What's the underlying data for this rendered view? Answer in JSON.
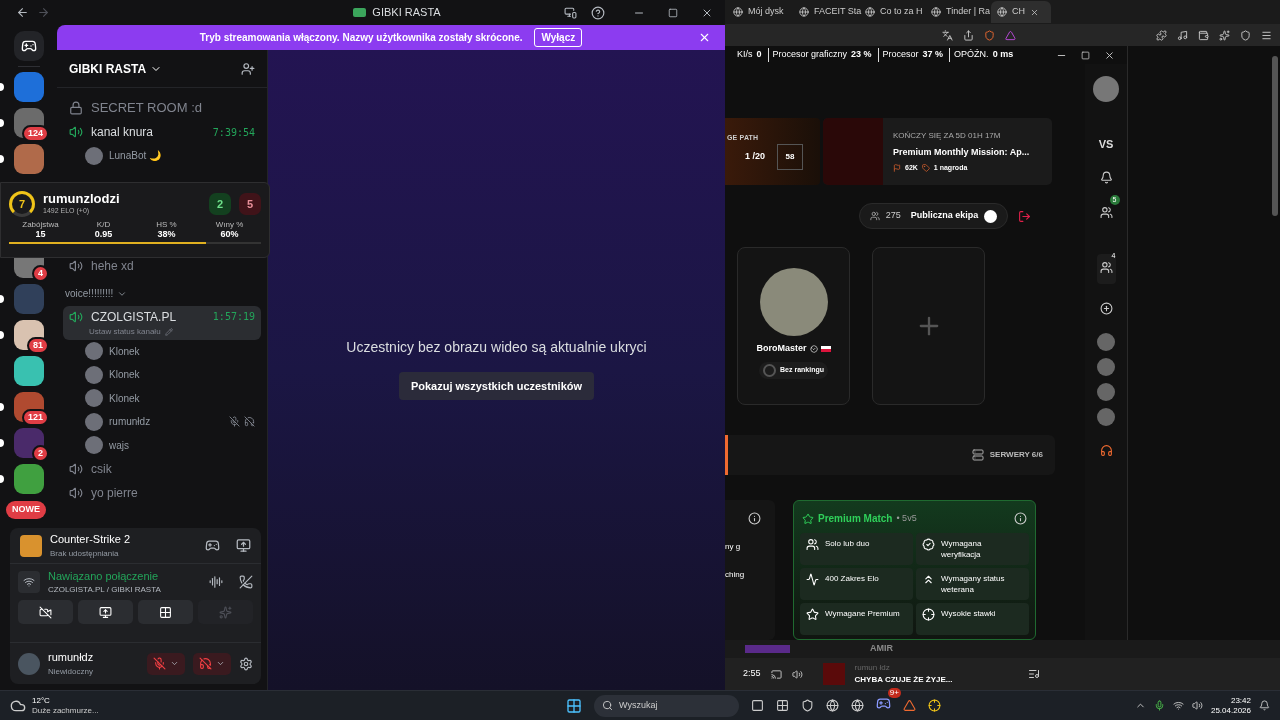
{
  "discord": {
    "title": "GIBKI RASTA",
    "banner": {
      "text": "Tryb streamowania włączony. Nazwy użytkownika zostały skrócone.",
      "button": "Wyłącz"
    },
    "servers": [
      {
        "unread": true
      },
      {
        "unread": true,
        "badge": "124"
      },
      {
        "unread": true
      },
      {
        "unread": false,
        "badge": "4"
      },
      {
        "unread": true
      },
      {
        "unread": true,
        "badge": "81"
      },
      {
        "unread": false
      },
      {
        "unread": true,
        "badge": "121"
      },
      {
        "unread": true,
        "badge": "2"
      },
      {
        "unread": true
      }
    ],
    "new_pill": "NOWE",
    "server_name": "GIBKI RASTA",
    "channels": [
      {
        "kind": "locked",
        "name": "SECRET ROOM :d"
      },
      {
        "kind": "voice",
        "name": "kanal knura",
        "active": true,
        "selected": false,
        "timer": "7:39:54",
        "members": [
          {
            "name": "LunaBot 🌙",
            "muted": false
          }
        ]
      },
      {
        "kind": "spacer"
      },
      {
        "kind": "voice",
        "name": "hehe xd",
        "active": false,
        "selected": false
      },
      {
        "kind": "category",
        "name": "voice!!!!!!!!!"
      },
      {
        "kind": "voice",
        "name": "CZOLGISTA.PL",
        "active": true,
        "selected": true,
        "timer": "1:57:19",
        "status": "Ustaw status kanału",
        "members": [
          {
            "name": "Klonek",
            "muted": false
          },
          {
            "name": "Klonek",
            "muted": false
          },
          {
            "name": "Klonek",
            "muted": false
          },
          {
            "name": "rumunłdz",
            "muted": true
          },
          {
            "name": "wajs",
            "muted": false
          }
        ]
      },
      {
        "kind": "voice",
        "name": "csik",
        "active": false,
        "selected": false
      },
      {
        "kind": "voice",
        "name": "yo pierre",
        "active": false,
        "selected": false
      }
    ],
    "activity": {
      "game": "Counter-Strike 2",
      "status": "Brak udostępniania"
    },
    "voice": {
      "status": "Nawiązano połączenie",
      "channel": "CZOLGISTA.PL / GIBKI RASTA"
    },
    "user": {
      "name": "rumunłdz",
      "status": "Niewidoczny",
      "mic_muted": true,
      "deafened": true
    },
    "main": {
      "message": "Uczestnicy bez obrazu wideo są aktualnie ukryci",
      "button": "Pokazuj wszystkich uczestników"
    }
  },
  "stats_overlay": {
    "level_badge": "7",
    "name": "rumunzlodzi",
    "elo": "1492 ELO (+0)",
    "wins": "2",
    "losses": "5",
    "level": 0.78,
    "stats": [
      {
        "label": "Zabójstwa",
        "value": "15"
      },
      {
        "label": "K/D",
        "value": "0.95"
      },
      {
        "label": "HS %",
        "value": "38%"
      },
      {
        "label": "Wıny %",
        "value": "60%"
      }
    ]
  },
  "browser": {
    "tabs": [
      {
        "title": "Mój dysk",
        "selected": false
      },
      {
        "title": "FACEIT Sta",
        "selected": false
      },
      {
        "title": "Co to za H",
        "selected": false
      },
      {
        "title": "Tinder | Ra",
        "selected": false
      },
      {
        "title": "CH",
        "selected": true
      }
    ],
    "osd": [
      {
        "label": "KI/s",
        "value": "0"
      },
      {
        "label": "Procesor graficzny",
        "value": "23 %"
      },
      {
        "label": "Procesor",
        "value": "37 %"
      },
      {
        "label": "OPÓŹN.",
        "value": "0 ms"
      }
    ]
  },
  "faceit": {
    "mission": {
      "path_label": "GE PATH",
      "progress": "1 /20",
      "level": "58",
      "ends": "KOŃCZY SIĘ ZA 5D 01H 17M",
      "title": "Premium Monthly Mission: Ap...",
      "points": "62K",
      "reward": "1 nagroda"
    },
    "party": {
      "count": "275",
      "label": "Publiczna ekipa",
      "public": true
    },
    "player": {
      "name": "BoroMaster",
      "rank": "Bez rankingu"
    },
    "servers": "SERWERY 6/6",
    "partial_card": [
      "ny g",
      "ching"
    ],
    "match": {
      "title": "Premium Match",
      "mode": "• 5v5",
      "features": [
        {
          "kind": "users",
          "text": "Solo lub duo"
        },
        {
          "kind": "verified",
          "text": "Wymagana weryfikacja"
        },
        {
          "kind": "elo",
          "text": "400 Zakres Elo"
        },
        {
          "kind": "veteran",
          "text": "Wymagany status weterana"
        },
        {
          "kind": "premium",
          "text": "Wymagane Premium"
        },
        {
          "kind": "stakes",
          "text": "Wysokie stawki"
        }
      ]
    },
    "rail": {
      "vs": "VS",
      "notif_badge": "5",
      "party_badge": "4"
    }
  },
  "media": {
    "partial_artist": "AMIR",
    "time": "2:55",
    "artist": "rumun łdz",
    "track": "CHYBA CZUJE ŻE ŻYJE..."
  },
  "taskbar": {
    "temp": "12°C",
    "weather": "Duże zachmurze...",
    "search": "Wyszukaj",
    "discord_badge": "9+",
    "time": "23:42",
    "date": "25.04.2026"
  }
}
